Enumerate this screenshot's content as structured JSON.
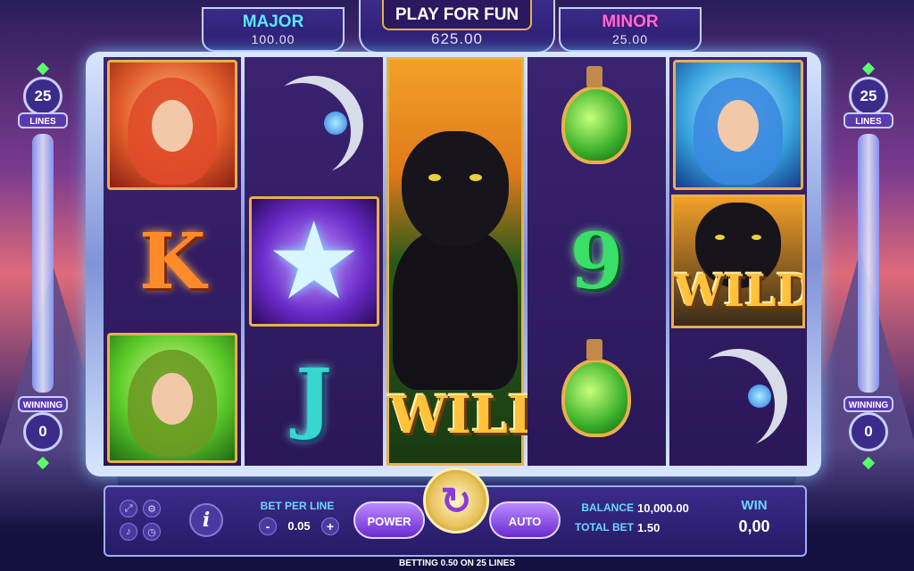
{
  "jackpots": {
    "major": {
      "label": "MAJOR",
      "value": "100.00"
    },
    "grand": {
      "value": "625.00"
    },
    "minor": {
      "label": "MINOR",
      "value": "25.00"
    }
  },
  "play_mode": "PLAY FOR FUN",
  "side_meters": {
    "lines_value": "25",
    "lines_label": "LINES",
    "winning_label": "WINNING",
    "winning_value": "0"
  },
  "reels": [
    [
      "fire-fairy",
      "K",
      "earth-fairy"
    ],
    [
      "crescent-moon",
      "star-wand",
      "J"
    ],
    [
      "panther-wild-stacked"
    ],
    [
      "potion",
      "9",
      "potion"
    ],
    [
      "water-fairy",
      "panther-wild",
      "crescent-moon"
    ]
  ],
  "wild_label": "WILD",
  "controls": {
    "bet_per_line_label": "BET PER LINE",
    "bet_per_line_value": "0.05",
    "minus": "-",
    "plus": "+",
    "power_label": "POWER",
    "auto_label": "AUTO",
    "spin_icon": "↻",
    "info_icon": "i",
    "balance_label": "BALANCE",
    "balance_value": "10,000.00",
    "total_bet_label": "TOTAL BET",
    "total_bet_value": "1.50",
    "win_label": "WIN",
    "win_value": "0,00"
  },
  "icons": [
    "fullscreen-icon",
    "settings-icon",
    "sound-icon",
    "history-icon"
  ],
  "betting_text": "BETTING 0.50 ON 25 LINES"
}
